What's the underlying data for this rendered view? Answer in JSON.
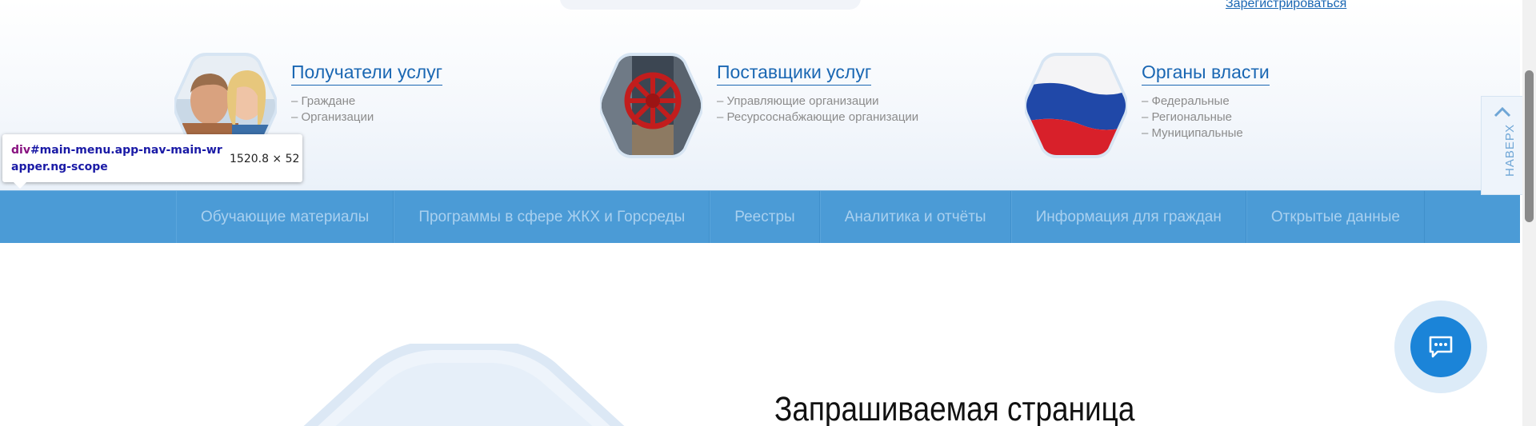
{
  "header": {
    "register_link": "Зарегистрироваться"
  },
  "categories": [
    {
      "title": "Получатели услуг",
      "image": "couple-photo",
      "items": [
        "– Граждане",
        "– Организации"
      ]
    },
    {
      "title": "Поставщики услуг",
      "image": "valve-photo",
      "items": [
        "– Управляющие организации",
        "– Ресурсоснабжающие организации"
      ]
    },
    {
      "title": "Органы власти",
      "image": "russian-flag",
      "items": [
        "– Федеральные",
        "– Региональные",
        "– Муниципальные"
      ]
    }
  ],
  "devtools_tooltip": {
    "tag": "div",
    "selector_line1": "#main-menu.app-nav-main-wr",
    "selector_line2": "apper.ng-scope",
    "dimensions": "1520.8 × 52"
  },
  "nav": {
    "items": [
      "Обучающие материалы",
      "Программы в сфере ЖКХ и Горсреды",
      "Реестры",
      "Аналитика и отчёты",
      "Информация для граждан",
      "Открытые данные"
    ]
  },
  "back_to_top": {
    "label": "НАВЕРХ",
    "icon": "chevron-up-icon"
  },
  "chat": {
    "icon": "chat-bubble-icon"
  },
  "main": {
    "heading": "Запрашиваемая страница"
  },
  "colors": {
    "nav_bg": "#4b9bd6",
    "nav_text": "#a9d0ef",
    "link": "#1a67b3",
    "chat_bg": "#1b84d8"
  }
}
